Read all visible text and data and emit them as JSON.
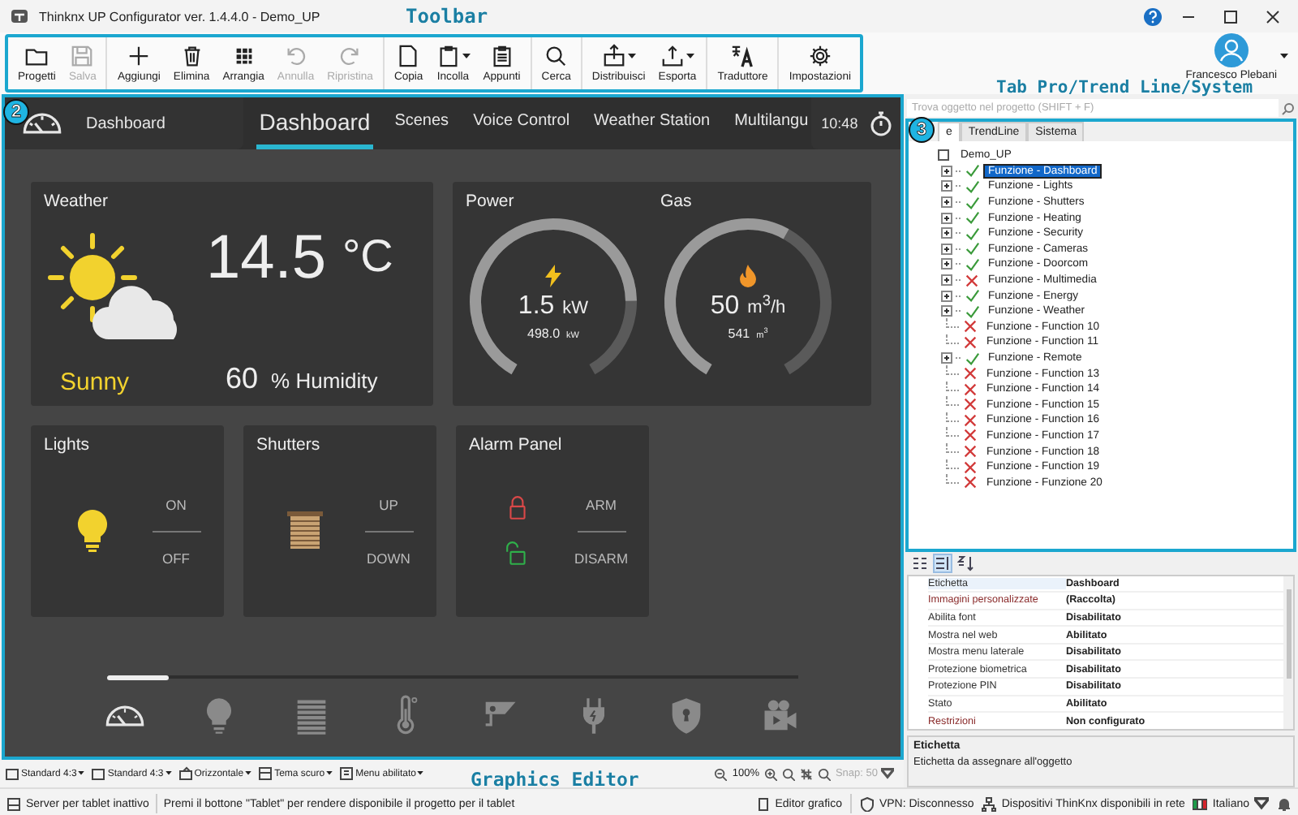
{
  "window": {
    "title": "Thinknx UP Configurator ver. 1.4.4.0 - Demo_UP"
  },
  "annotations": {
    "toolbar": "Toolbar",
    "tabs": "Tab Pro/Trend Line/System",
    "editor": "Graphics Editor",
    "editor_badge": "2",
    "tree_badge": "3"
  },
  "toolbar": {
    "groups": [
      [
        {
          "label": "Progetti",
          "disabled": false,
          "dropdown": false
        },
        {
          "label": "Salva",
          "disabled": true,
          "dropdown": false
        }
      ],
      [
        {
          "label": "Aggiungi",
          "disabled": false,
          "dropdown": false
        },
        {
          "label": "Elimina",
          "disabled": false,
          "dropdown": false
        },
        {
          "label": "Arrangia",
          "disabled": false,
          "dropdown": false
        },
        {
          "label": "Annulla",
          "disabled": true,
          "dropdown": false
        },
        {
          "label": "Ripristina",
          "disabled": true,
          "dropdown": false
        }
      ],
      [
        {
          "label": "Copia",
          "disabled": false,
          "dropdown": false
        },
        {
          "label": "Incolla",
          "disabled": false,
          "dropdown": true
        },
        {
          "label": "Appunti",
          "disabled": false,
          "dropdown": false
        }
      ],
      [
        {
          "label": "Cerca",
          "disabled": false,
          "dropdown": false
        }
      ],
      [
        {
          "label": "Distribuisci",
          "disabled": false,
          "dropdown": true
        },
        {
          "label": "Esporta",
          "disabled": false,
          "dropdown": true
        }
      ],
      [
        {
          "label": "Traduttore",
          "disabled": false,
          "dropdown": false
        }
      ],
      [
        {
          "label": "Impostazioni",
          "disabled": false,
          "dropdown": false
        }
      ]
    ]
  },
  "user": {
    "name": "Francesco Plebani"
  },
  "editor": {
    "header": {
      "page": "Dashboard",
      "time": "10:48"
    },
    "tabs": [
      {
        "label": "Dashboard",
        "selected": true
      },
      {
        "label": "Scenes",
        "selected": false
      },
      {
        "label": "Voice Control",
        "selected": false
      },
      {
        "label": "Weather Station",
        "selected": false
      },
      {
        "label": "Multilangu",
        "selected": false
      }
    ],
    "weather": {
      "title": "Weather",
      "temperature": "14.5",
      "unit": "°C",
      "condition": "Sunny",
      "humidity": "60",
      "humidity_label": "% Humidity"
    },
    "meters": {
      "title_left": "Power",
      "title_right": "Gas",
      "gauges": [
        {
          "kind": "power",
          "value": "1.5",
          "unit": "kW",
          "total": "498.0",
          "total_unit": "kW"
        },
        {
          "kind": "gas",
          "value": "50",
          "unit": "m$^{3}$/h",
          "total": "541",
          "total_unit": "m$^{3}$"
        }
      ]
    },
    "controls": [
      {
        "kind": "light",
        "title": "Lights",
        "top": "ON",
        "bottom": "OFF"
      },
      {
        "kind": "shutter",
        "title": "Shutters",
        "top": "UP",
        "bottom": "DOWN"
      },
      {
        "kind": "alarm",
        "title": "Alarm Panel",
        "top": "ARM",
        "bottom": "DISARM"
      }
    ],
    "nav": [
      {
        "selected": true
      },
      {
        "selected": false
      },
      {
        "selected": false
      },
      {
        "selected": false
      },
      {
        "selected": false
      },
      {
        "selected": false
      },
      {
        "selected": false
      },
      {
        "selected": false
      }
    ]
  },
  "editor_toolbar_x": {
    "items": [
      {
        "label": "Standard 4:3"
      },
      {
        "label": "Standard 4:3"
      },
      {
        "label": "Orizzontale"
      },
      {
        "label": "Tema scuro"
      },
      {
        "label": "Menu abilitato"
      }
    ],
    "zoom": "100%",
    "snap": "Snap: 50",
    "snap_disabled": true
  },
  "project": {
    "search": {
      "placeholder": "Trova oggetto nel progetto (SHIFT + F)"
    },
    "tabs": [
      {
        "label": "e",
        "selected": true
      },
      {
        "label": "TrendLine",
        "selected": false
      },
      {
        "label": "Sistema",
        "selected": false
      }
    ],
    "tree": {
      "label": "Demo_UP",
      "children": [
        {
          "label": "Funzione - Dashboard",
          "kind": "group",
          "valid": true,
          "selected": true
        },
        {
          "label": "Funzione - Lights",
          "kind": "group",
          "valid": true,
          "selected": false
        },
        {
          "label": "Funzione - Shutters",
          "kind": "group",
          "valid": true,
          "selected": false
        },
        {
          "label": "Funzione - Heating",
          "kind": "group",
          "valid": true,
          "selected": false
        },
        {
          "label": "Funzione - Security",
          "kind": "group",
          "valid": true,
          "selected": false
        },
        {
          "label": "Funzione - Cameras",
          "kind": "group",
          "valid": true,
          "selected": false
        },
        {
          "label": "Funzione - Doorcom",
          "kind": "group",
          "valid": true,
          "selected": false
        },
        {
          "label": "Funzione - Multimedia",
          "kind": "group",
          "valid": false,
          "selected": false
        },
        {
          "label": "Funzione - Energy",
          "kind": "group",
          "valid": true,
          "selected": false
        },
        {
          "label": "Funzione - Weather",
          "kind": "group",
          "valid": true,
          "selected": false
        },
        {
          "label": "Funzione - Function 10",
          "kind": "item",
          "valid": false,
          "selected": false
        },
        {
          "label": "Funzione - Function 11",
          "kind": "item",
          "valid": false,
          "selected": false
        },
        {
          "label": "Funzione - Remote",
          "kind": "group",
          "valid": true,
          "selected": false
        },
        {
          "label": "Funzione - Function 13",
          "kind": "item",
          "valid": false,
          "selected": false
        },
        {
          "label": "Funzione - Function 14",
          "kind": "item",
          "valid": false,
          "selected": false
        },
        {
          "label": "Funzione - Function 15",
          "kind": "item",
          "valid": false,
          "selected": false
        },
        {
          "label": "Funzione - Function 16",
          "kind": "item",
          "valid": false,
          "selected": false
        },
        {
          "label": "Funzione - Function 17",
          "kind": "item",
          "valid": false,
          "selected": false
        },
        {
          "label": "Funzione - Function 18",
          "kind": "item",
          "valid": false,
          "selected": false
        },
        {
          "label": "Funzione - Function 19",
          "kind": "item",
          "valid": false,
          "selected": false
        },
        {
          "label": "Funzione - Funzione 20",
          "kind": "item",
          "valid": false,
          "selected": false
        }
      ]
    }
  },
  "properties": {
    "rows": [
      {
        "label": "Etichetta",
        "value": "Dashboard",
        "selected": true,
        "modified": false
      },
      {
        "label": "Immagini personalizzate",
        "value": "(Raccolta)",
        "selected": false,
        "modified": true
      },
      {
        "label": "Abilita font",
        "value": "Disabilitato",
        "selected": false,
        "modified": false
      },
      {
        "label": "Mostra nel web",
        "value": "Abilitato",
        "selected": false,
        "modified": false
      },
      {
        "label": "Mostra menu laterale",
        "value": "Disabilitato",
        "selected": false,
        "modified": false
      },
      {
        "label": "Protezione biometrica",
        "value": "Disabilitato",
        "selected": false,
        "modified": false
      },
      {
        "label": "Protezione PIN",
        "value": "Disabilitato",
        "selected": false,
        "modified": false
      },
      {
        "label": "Stato",
        "value": "Abilitato",
        "selected": false,
        "modified": false
      },
      {
        "label": "Restrizioni",
        "value": "Non configurato",
        "selected": false,
        "modified": true
      }
    ],
    "description": {
      "title": "Etichetta",
      "text": "Etichetta da assegnare all'oggetto"
    }
  },
  "status_bar": {
    "server": "Server per tablet inattivo",
    "hint": "Premi il bottone \"Tablet\" per rendere disponibile il progetto per il tablet",
    "editor": "Editor grafico",
    "vpn": "VPN: Disconnesso",
    "devices": "Dispositivi ThinKnx disponibili in rete",
    "language": "Italiano"
  }
}
